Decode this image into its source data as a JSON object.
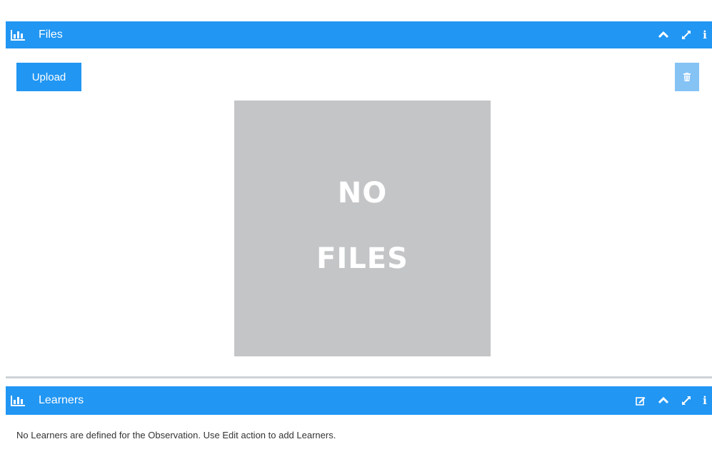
{
  "files_panel": {
    "title": "Files",
    "upload_label": "Upload",
    "placeholder_line1": "NO",
    "placeholder_line2": "FILES",
    "tools": [
      "chevron-up-icon",
      "expand-icon",
      "info-icon"
    ]
  },
  "learners_panel": {
    "title": "Learners",
    "message": "No Learners are defined for the Observation. Use Edit action to add Learners.",
    "tools": [
      "edit-icon",
      "chevron-up-icon",
      "expand-icon",
      "info-icon"
    ]
  },
  "info_glyph": "i",
  "colors": {
    "header_bg": "#2196f3",
    "button_primary": "#2196f3",
    "button_disabled": "#86c3f5",
    "placeholder_bg": "#c4c5c7"
  }
}
